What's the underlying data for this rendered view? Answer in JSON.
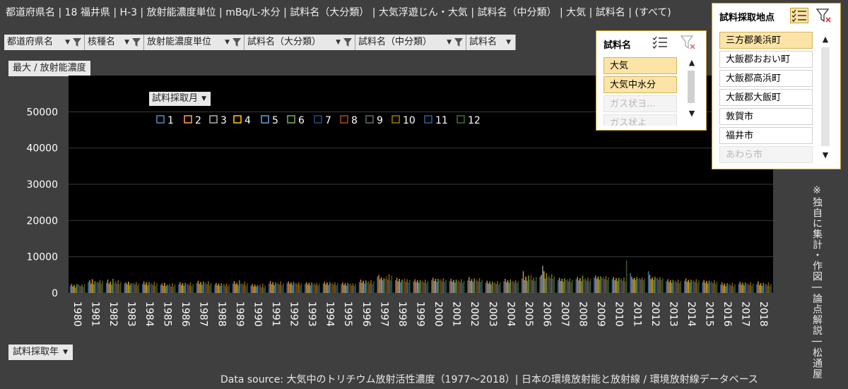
{
  "topbar": {
    "text": "都道府県名 | 18 福井県 | H-3 | 放射能濃度単位 | mBq/L-水分 | 試料名（大分類） | 大気浮遊じん・大気 | 試料名（中分類） | 大気 | 試料名 | (すべて)"
  },
  "fields": [
    "都道府県名",
    "核種名",
    "放射能濃度単位",
    "試料名（大分類）",
    "試料名（中分類）",
    "試料名"
  ],
  "value_field": "最大 / 放射能濃度",
  "legend_field": "試料採取月",
  "axis_field": "試料採取年",
  "source": "Data source: 大気中のトリチウム放射活性濃度（1977〜2018）| 日本の環境放射能と放射線 / 環境放射線データベース",
  "side_note": "※独自に集計・作図 | 論点解説 | 松通屋",
  "slicer_name": {
    "title": "試料名",
    "items": [
      {
        "label": "大気",
        "state": "selected"
      },
      {
        "label": "大気中水分",
        "state": "selected"
      },
      {
        "label": "ガス状ヨ...",
        "state": "dim"
      },
      {
        "label": "ガス状よ",
        "state": "dim"
      }
    ]
  },
  "slicer_site": {
    "title": "試料採取地点",
    "items": [
      {
        "label": "三方郡美浜町",
        "state": "selected"
      },
      {
        "label": "大飯郡おおい町",
        "state": "normal"
      },
      {
        "label": "大飯郡高浜町",
        "state": "normal"
      },
      {
        "label": "大飯郡大飯町",
        "state": "normal"
      },
      {
        "label": "敦賀市",
        "state": "normal"
      },
      {
        "label": "福井市",
        "state": "normal"
      },
      {
        "label": "あわら市",
        "state": "dim"
      }
    ]
  },
  "icons": {
    "filter": "filter-icon",
    "multi_select": "multi-select-icon",
    "clear_filter": "clear-filter-icon",
    "dropdown": "chevron-down-icon"
  },
  "chart_data": {
    "type": "bar",
    "ylabel": "最大 / 放射能濃度",
    "xlabel": "試料採取年",
    "ylim": [
      0,
      60000
    ],
    "yticks": [
      0,
      10000,
      20000,
      30000,
      40000,
      50000
    ],
    "grid": true,
    "legend_position": "top-left",
    "series_names": [
      "1",
      "2",
      "3",
      "4",
      "5",
      "6",
      "7",
      "8",
      "9",
      "10",
      "11",
      "12"
    ],
    "series_colors": [
      "#4f81bd",
      "#f79646",
      "#a5a5a5",
      "#ffc000",
      "#5b9bd5",
      "#70ad47",
      "#264478",
      "#9e480e",
      "#636363",
      "#997300",
      "#255e91",
      "#43682b"
    ],
    "categories": [
      "1980",
      "1981",
      "1982",
      "1983",
      "1984",
      "1985",
      "1986",
      "1987",
      "1988",
      "1989",
      "1990",
      "1991",
      "1992",
      "1993",
      "1994",
      "1995",
      "1996",
      "1997",
      "1998",
      "1999",
      "2000",
      "2001",
      "2002",
      "2003",
      "2004",
      "2005",
      "2006",
      "2007",
      "2008",
      "2009",
      "2010",
      "2011",
      "2012",
      "2013",
      "2014",
      "2015",
      "2016",
      "2017",
      "2018"
    ],
    "values": [
      [
        2000,
        2500,
        1800,
        2200,
        1500,
        2400,
        2600,
        2100,
        1900,
        2300,
        1700,
        2500
      ],
      [
        3000,
        3500,
        2600,
        3800,
        2400,
        3300,
        2800,
        3100,
        2900,
        3600,
        2500,
        3400
      ],
      [
        2800,
        3700,
        2500,
        3100,
        2300,
        3900,
        2700,
        3300,
        2600,
        3500,
        2400,
        3000
      ],
      [
        2600,
        2900,
        2400,
        3100,
        2200,
        2700,
        2500,
        2800,
        2300,
        3000,
        2100,
        2600
      ],
      [
        2500,
        3200,
        2300,
        2900,
        2100,
        3000,
        2400,
        2700,
        2200,
        3100,
        2000,
        2800
      ],
      [
        2200,
        2600,
        2000,
        2800,
        1900,
        2300,
        2100,
        2500,
        1800,
        2700,
        1700,
        2400
      ],
      [
        2400,
        3000,
        2200,
        2700,
        2000,
        2800,
        2300,
        2600,
        2100,
        2900,
        1900,
        2500
      ],
      [
        2700,
        3400,
        2500,
        3000,
        2300,
        3200,
        2600,
        2900,
        2400,
        3300,
        2200,
        2800
      ],
      [
        2300,
        2800,
        2100,
        2600,
        1900,
        2700,
        2200,
        2500,
        2000,
        2600,
        1800,
        2400
      ],
      [
        2600,
        3300,
        2400,
        2800,
        2200,
        3500,
        2500,
        2700,
        2300,
        3100,
        2100,
        2700
      ],
      [
        2000,
        2500,
        1800,
        2300,
        1700,
        2200,
        1900,
        2400,
        1600,
        2600,
        1500,
        2100
      ],
      [
        2600,
        3300,
        2400,
        3000,
        2200,
        2900,
        2500,
        2800,
        2300,
        3200,
        2100,
        2700
      ],
      [
        2700,
        3200,
        2500,
        2900,
        2300,
        3100,
        2600,
        2800,
        2400,
        3000,
        2200,
        2700
      ],
      [
        2500,
        3000,
        2300,
        2800,
        2100,
        2900,
        2400,
        2700,
        2200,
        2800,
        2000,
        2600
      ],
      [
        2600,
        3100,
        2400,
        2900,
        2200,
        3000,
        2500,
        2800,
        2300,
        2900,
        2100,
        2700
      ],
      [
        2400,
        2900,
        2200,
        2700,
        2000,
        2800,
        2300,
        2600,
        2100,
        2700,
        1900,
        2500
      ],
      [
        3000,
        3700,
        2800,
        3400,
        2600,
        3500,
        2900,
        3300,
        2700,
        3600,
        2500,
        3200
      ],
      [
        4500,
        5000,
        3800,
        4300,
        3500,
        4100,
        3900,
        4600,
        3700,
        5200,
        3400,
        4800
      ],
      [
        3500,
        4200,
        3200,
        3900,
        3000,
        3700,
        3400,
        4000,
        3100,
        3800,
        2900,
        3600
      ],
      [
        3200,
        3800,
        3000,
        3500,
        2800,
        3600,
        3100,
        3400,
        2900,
        3700,
        2700,
        3300
      ],
      [
        3600,
        4200,
        3300,
        3900,
        3100,
        4000,
        3500,
        3800,
        3200,
        4100,
        3000,
        3700
      ],
      [
        3300,
        3900,
        3100,
        3600,
        2900,
        3700,
        3200,
        3500,
        3000,
        3800,
        2800,
        3400
      ],
      [
        3500,
        4400,
        3300,
        3800,
        3100,
        4000,
        3400,
        3700,
        3200,
        4100,
        3000,
        3600
      ],
      [
        2800,
        3400,
        2600,
        3100,
        2400,
        3200,
        2700,
        3000,
        2500,
        3300,
        2300,
        2900
      ],
      [
        3200,
        3900,
        3000,
        3500,
        2800,
        3700,
        3100,
        3400,
        2900,
        3600,
        2700,
        3300
      ],
      [
        4000,
        6000,
        3600,
        4500,
        3400,
        4800,
        3800,
        5000,
        3500,
        4200,
        3300,
        4400
      ],
      [
        4500,
        5000,
        7500,
        6000,
        4000,
        5500,
        4300,
        4800,
        4100,
        5200,
        3900,
        4600
      ],
      [
        3600,
        4200,
        3300,
        3900,
        3100,
        4100,
        3500,
        3800,
        3200,
        4000,
        3000,
        3700
      ],
      [
        3800,
        4400,
        3500,
        4100,
        3300,
        4800,
        3700,
        4000,
        3400,
        4200,
        3200,
        3900
      ],
      [
        4200,
        4800,
        3900,
        4500,
        3700,
        4600,
        4100,
        4400,
        3800,
        4700,
        3600,
        4300
      ],
      [
        3800,
        4400,
        3500,
        4100,
        3300,
        4200,
        3700,
        4000,
        3400,
        4300,
        3200,
        9000
      ],
      [
        5500,
        4500,
        3800,
        4200,
        3600,
        4400,
        3900,
        4100,
        3700,
        4300,
        3500,
        4000
      ],
      [
        6000,
        5000,
        3800,
        4300,
        3600,
        4500,
        4000,
        4200,
        3700,
        4400,
        3500,
        4100
      ],
      [
        3200,
        3800,
        3000,
        3500,
        2800,
        3600,
        3100,
        3400,
        2900,
        3700,
        2700,
        3300
      ],
      [
        3300,
        4000,
        3100,
        3600,
        2900,
        3700,
        3200,
        3500,
        3000,
        3800,
        2800,
        3400
      ],
      [
        3000,
        3600,
        2800,
        3300,
        2600,
        3400,
        2900,
        3200,
        2700,
        3500,
        2500,
        3100
      ],
      [
        2300,
        2900,
        2100,
        2600,
        1900,
        2700,
        2200,
        2500,
        2000,
        2800,
        1800,
        2400
      ],
      [
        2500,
        3100,
        2300,
        2800,
        2100,
        2900,
        2400,
        2700,
        2200,
        3000,
        2000,
        2600
      ],
      [
        2400,
        3200,
        2200,
        2700,
        2000,
        2800,
        2300,
        2600,
        2100,
        2900,
        1900,
        2500
      ]
    ]
  }
}
